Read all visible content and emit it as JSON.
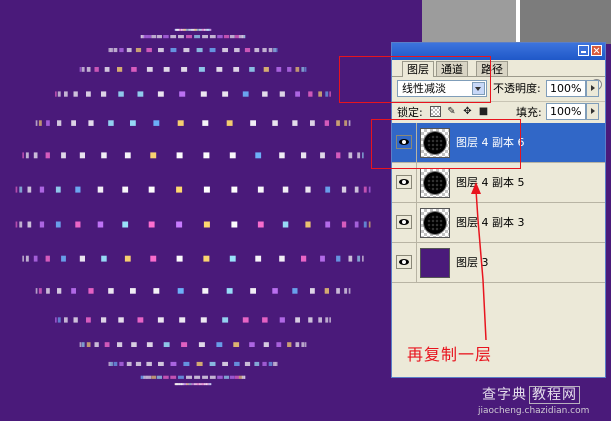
{
  "colors": {
    "canvas_bg": "#4a1a7a",
    "annotation": "#e8141e",
    "selected_row": "#3167c7",
    "dot_colors": [
      "#ffffff",
      "#ffffff",
      "#ffffff",
      "#ffffff",
      "#ff6fd0",
      "#6fb8ff",
      "#9ce8ff",
      "#ffd86f",
      "#c87bff"
    ]
  },
  "palette": {
    "tabs": [
      {
        "label": "图层",
        "active": true
      },
      {
        "label": "通道",
        "active": false
      },
      {
        "label": "路径",
        "active": false
      }
    ],
    "blend_mode": "线性减淡",
    "opacity_label": "不透明度:",
    "opacity_value": "100%",
    "lock_label": "锁定:",
    "fill_label": "填充:",
    "fill_value": "100%",
    "layers": [
      {
        "name": "图层 4 副本 6",
        "selected": true,
        "thumb": "disk",
        "icon": "eye-icon"
      },
      {
        "name": "图层 4 副本 5",
        "selected": false,
        "thumb": "disk",
        "icon": "eye-icon"
      },
      {
        "name": "图层 4 副本 3",
        "selected": false,
        "thumb": "disk",
        "icon": "eye-icon"
      },
      {
        "name": "图层 3",
        "selected": false,
        "thumb": "purple",
        "icon": "eye-icon"
      }
    ]
  },
  "annotation": {
    "text": "再复制一层"
  },
  "watermark": {
    "cn_1": "查字典",
    "cn_2": "教程网",
    "url": "jiaocheng.chazidian.com"
  }
}
